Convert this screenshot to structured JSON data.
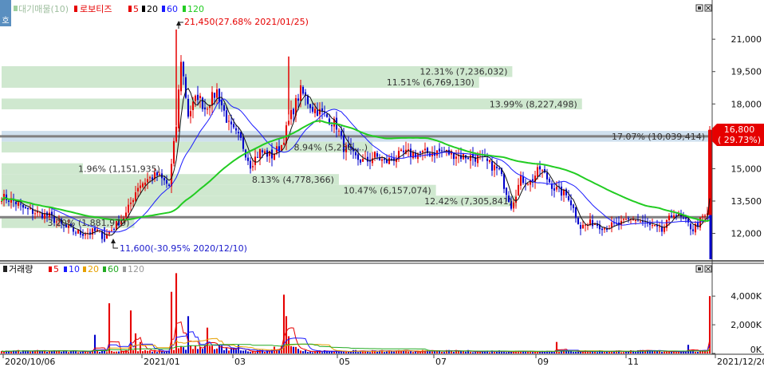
{
  "price_panel": {
    "legend": {
      "volume_profile": "대기매물(10)",
      "stock_name": "로보티즈",
      "ma_5": "5",
      "ma_20": "20",
      "ma_60": "60",
      "ma_120": "120"
    },
    "current_price": "16,800",
    "current_change": "( 29.73%)",
    "high_marker": "21,450(27.68% 2021/01/25)",
    "low_marker": "11,600(-30.95% 2020/12/10)"
  },
  "volume_panel": {
    "legend": {
      "title": "거래량",
      "ma_5": "5",
      "ma_10": "10",
      "ma_20": "20",
      "ma_60": "60",
      "ma_120": "120"
    }
  },
  "colors": {
    "up": "#e60000",
    "down": "#0000cc",
    "ma5": "#000000",
    "ma20": "#1a1aff",
    "ma60": "#22cc22",
    "band": "#cfe8cf",
    "band_current": "#cfe0ee",
    "hline": "#808080"
  },
  "chart_data": [
    {
      "type": "candlestick",
      "title": "로보티즈",
      "ylim": [
        10800,
        22300
      ],
      "yticks": [
        {
          "value": 12000,
          "label": "12,000"
        },
        {
          "value": 13500,
          "label": "13,500"
        },
        {
          "value": 15000,
          "label": "15,000"
        },
        {
          "value": 16500,
          "label": "16,500"
        },
        {
          "value": 18000,
          "label": "18,000"
        },
        {
          "value": 19500,
          "label": "19,500"
        },
        {
          "value": 21000,
          "label": "21,000"
        }
      ],
      "x_labels": [
        "2020/10/06",
        "2021/01",
        "03",
        "05",
        "07",
        "09",
        "11",
        "2021/12/20"
      ],
      "horizontal_lines": [
        16500,
        12750
      ],
      "volume_profile": [
        {
          "from": 19250,
          "to": 19750,
          "label": "12.31% (7,236,032)"
        },
        {
          "from": 18750,
          "to": 19250,
          "label": "11.51% (6,769,130)"
        },
        {
          "from": 17750,
          "to": 18250,
          "label": "13.99% (8,227,498)"
        },
        {
          "from": 16250,
          "to": 16750,
          "label": "17.07% (10,039,414)"
        },
        {
          "from": 15750,
          "to": 16250,
          "label": "8.94% (5,256,...)"
        },
        {
          "from": 14750,
          "to": 15250,
          "label": "1.96% (1,151,935)"
        },
        {
          "from": 14250,
          "to": 14750,
          "label": "8.13% (4,778,366)"
        },
        {
          "from": 13750,
          "to": 14250,
          "label": "10.47% (6,157,074)"
        },
        {
          "from": 13250,
          "to": 13750,
          "label": "12.42% (7,305,841)"
        },
        {
          "from": 12250,
          "to": 12750,
          "label": "3.20% (1,881,979)"
        }
      ],
      "close_waypoints": [
        [
          0,
          13700
        ],
        [
          5,
          13500
        ],
        [
          10,
          13100
        ],
        [
          20,
          12800
        ],
        [
          26,
          12300
        ],
        [
          33,
          12000
        ],
        [
          40,
          12100
        ],
        [
          43,
          11800
        ],
        [
          47,
          12300
        ],
        [
          52,
          12900
        ],
        [
          57,
          14200
        ],
        [
          61,
          14500
        ],
        [
          65,
          14700
        ],
        [
          70,
          14200
        ],
        [
          73,
          17000
        ],
        [
          75,
          20100
        ],
        [
          78,
          17500
        ],
        [
          82,
          18400
        ],
        [
          85,
          17800
        ],
        [
          90,
          18600
        ],
        [
          95,
          17000
        ],
        [
          100,
          16300
        ],
        [
          104,
          15200
        ],
        [
          108,
          15800
        ],
        [
          113,
          15600
        ],
        [
          117,
          16100
        ],
        [
          121,
          17500
        ],
        [
          125,
          18600
        ],
        [
          130,
          17800
        ],
        [
          135,
          17500
        ],
        [
          140,
          17000
        ],
        [
          143,
          16000
        ],
        [
          148,
          15500
        ],
        [
          152,
          15300
        ],
        [
          156,
          15600
        ],
        [
          160,
          15300
        ],
        [
          168,
          15700
        ],
        [
          176,
          15700
        ],
        [
          184,
          15800
        ],
        [
          192,
          15600
        ],
        [
          200,
          15500
        ],
        [
          208,
          14900
        ],
        [
          213,
          13300
        ],
        [
          217,
          14500
        ],
        [
          221,
          14400
        ],
        [
          225,
          15000
        ],
        [
          231,
          14100
        ],
        [
          237,
          13700
        ],
        [
          242,
          12300
        ],
        [
          247,
          12500
        ],
        [
          252,
          12300
        ],
        [
          258,
          12400
        ],
        [
          264,
          12700
        ],
        [
          270,
          12400
        ],
        [
          276,
          12100
        ],
        [
          281,
          13000
        ],
        [
          285,
          12600
        ],
        [
          289,
          12200
        ],
        [
          293,
          12700
        ],
        [
          295,
          12850
        ],
        [
          296,
          16800
        ]
      ]
    },
    {
      "type": "bar",
      "title": "거래량",
      "ylim": [
        0,
        5400000
      ],
      "yticks": [
        {
          "value": 0,
          "label": "0K"
        },
        {
          "value": 2000000,
          "label": "2,000K"
        },
        {
          "value": 4000000,
          "label": "4,000K"
        }
      ],
      "spikes": [
        [
          39,
          1300000
        ],
        [
          45,
          3500000
        ],
        [
          54,
          3000000
        ],
        [
          56,
          1400000
        ],
        [
          58,
          800000
        ],
        [
          71,
          4300000
        ],
        [
          73,
          5600000
        ],
        [
          78,
          2600000
        ],
        [
          86,
          1800000
        ],
        [
          118,
          4100000
        ],
        [
          119,
          2600000
        ],
        [
          120,
          1200000
        ],
        [
          232,
          800000
        ],
        [
          287,
          600000
        ],
        [
          296,
          4000000
        ]
      ]
    }
  ]
}
